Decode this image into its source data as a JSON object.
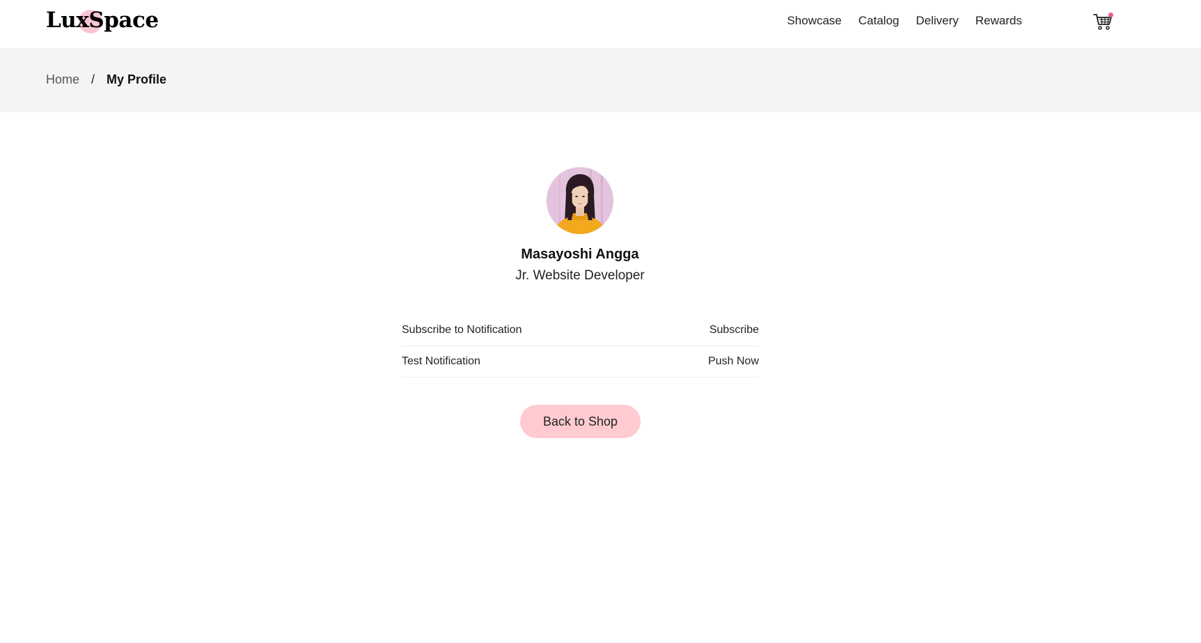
{
  "brand": {
    "logo_text": "LuxSpace",
    "accent_color": "#f9c6d3",
    "badge_color": "#ec5a94"
  },
  "nav": {
    "items": [
      {
        "label": "Showcase"
      },
      {
        "label": "Catalog"
      },
      {
        "label": "Delivery"
      },
      {
        "label": "Rewards"
      }
    ],
    "cart_icon": "cart-icon"
  },
  "breadcrumb": {
    "home": "Home",
    "separator": "/",
    "current": "My Profile"
  },
  "profile": {
    "name": "Masayoshi Angga",
    "role": "Jr. Website Developer"
  },
  "settings": {
    "rows": [
      {
        "label": "Subscribe to Notification",
        "action": "Subscribe"
      },
      {
        "label": "Test Notification",
        "action": "Push Now"
      }
    ]
  },
  "actions": {
    "back_label": "Back to Shop",
    "back_color": "#ffcbd1"
  }
}
